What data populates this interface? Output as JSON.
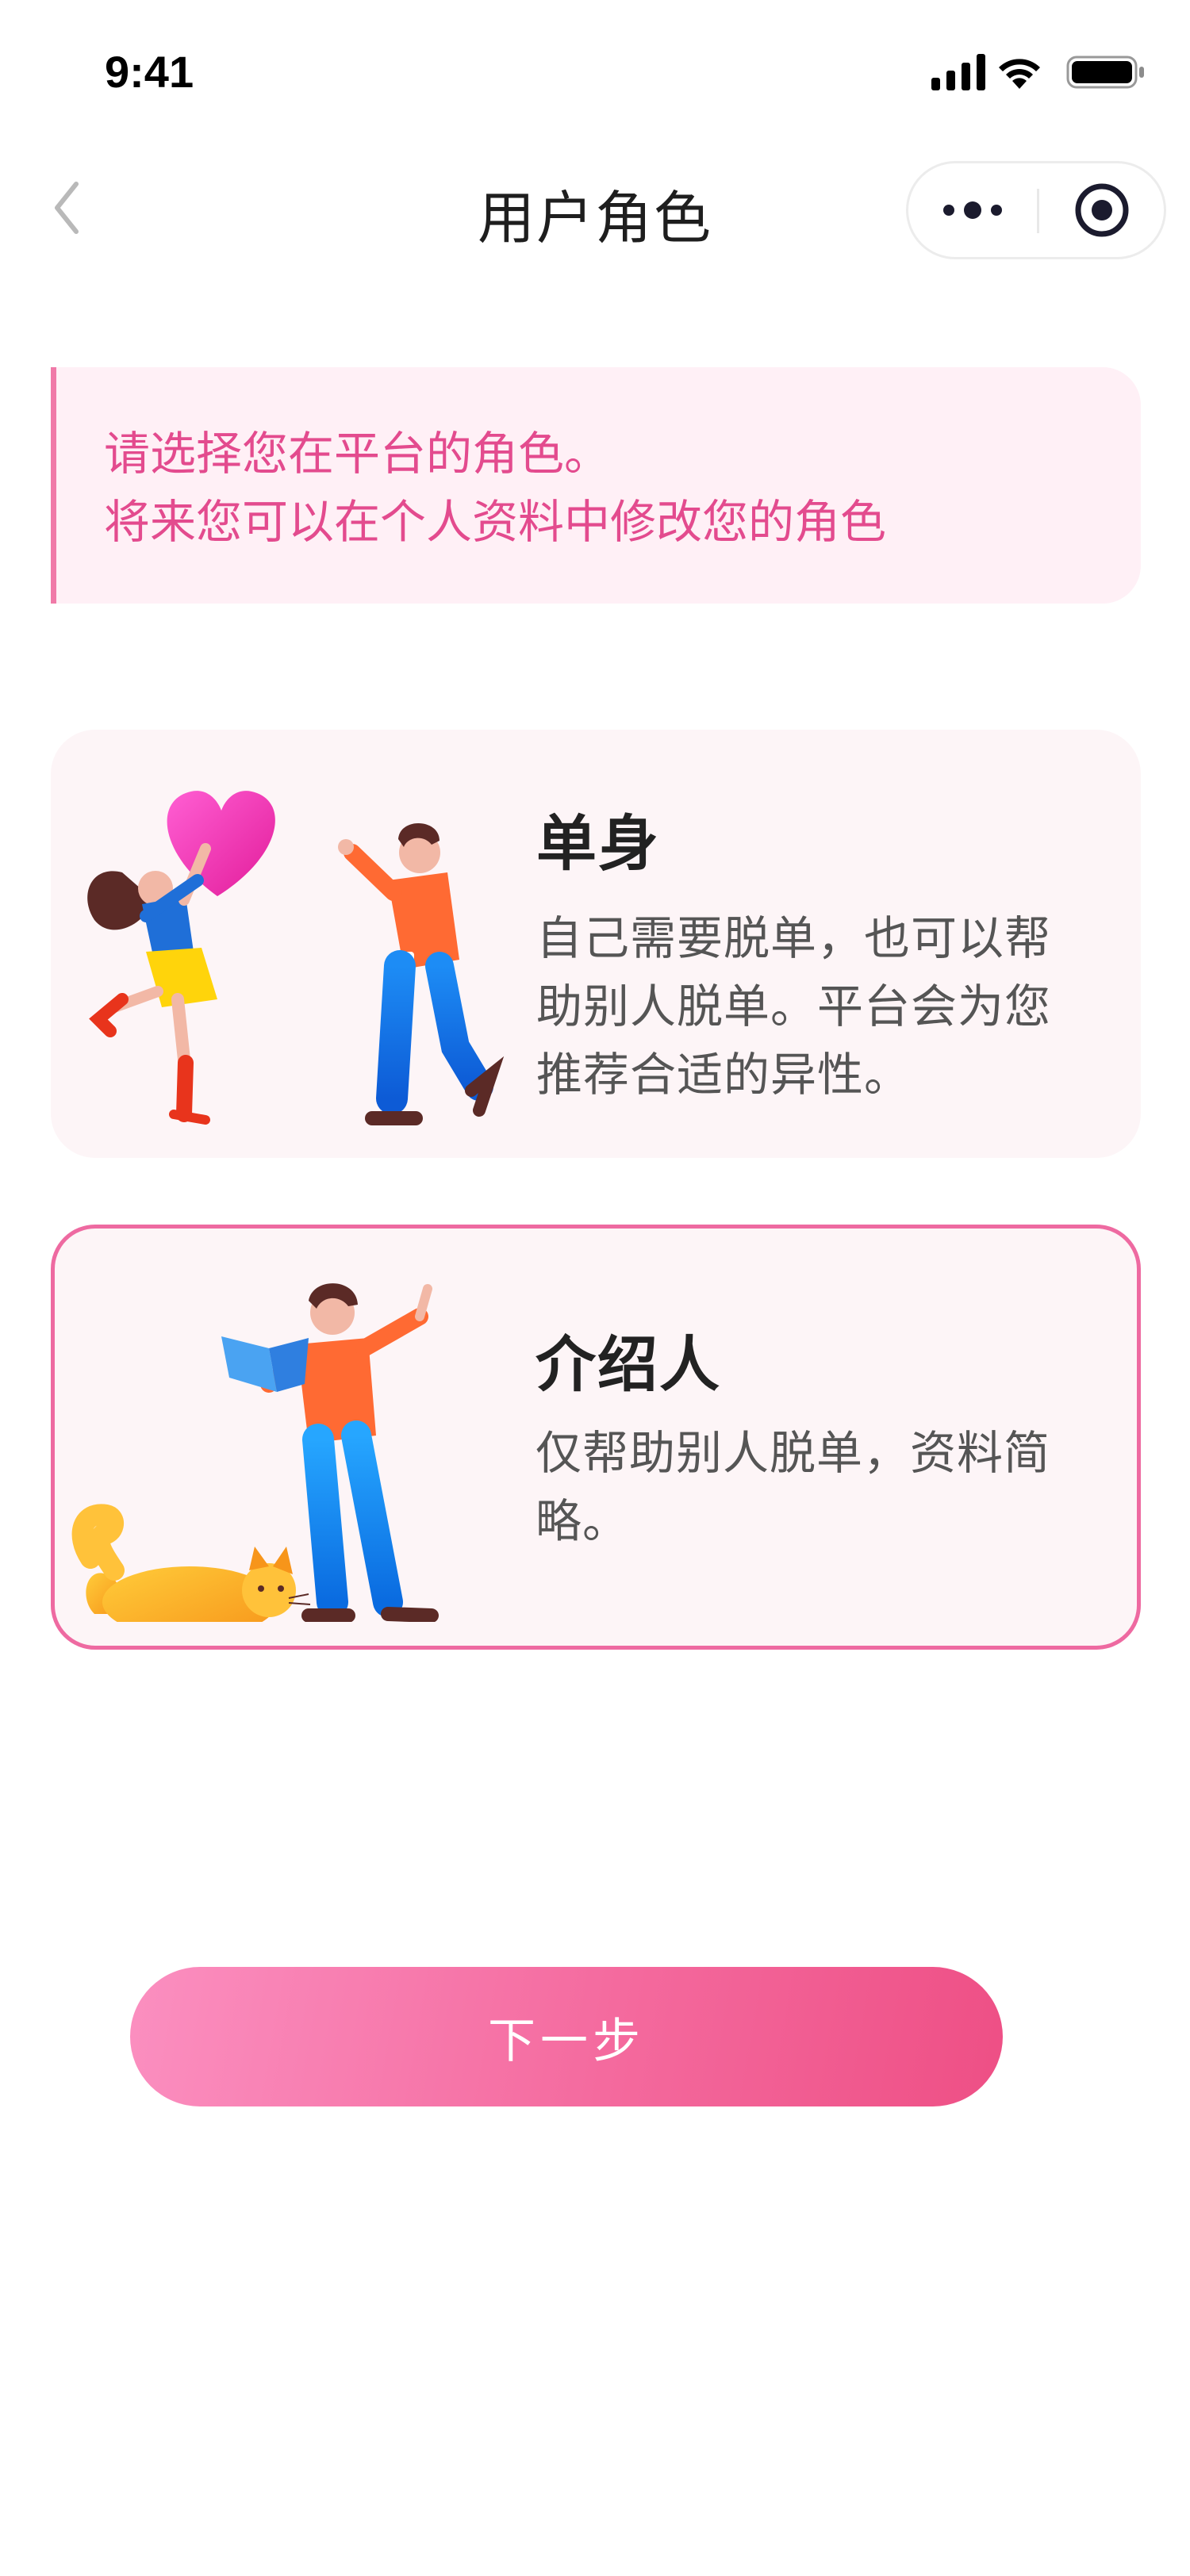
{
  "status_bar": {
    "time": "9:41"
  },
  "nav": {
    "title": "用户角色"
  },
  "notice": {
    "line1": "请选择您在平台的角色。",
    "line2": "将来您可以在个人资料中修改您的角色"
  },
  "roles": [
    {
      "title": "单身",
      "description": "自己需要脱单，也可以帮助别人脱单。平台会为您推荐合适的异性。",
      "selected": false
    },
    {
      "title": "介绍人",
      "description": "仅帮助别人脱单，资料简略。",
      "selected": true
    }
  ],
  "next_button": {
    "label": "下一步"
  },
  "colors": {
    "accent_pink": "#ee6aa1",
    "notice_text": "#e34b8e",
    "notice_bg": "#fff0f6",
    "card_bg": "#fdf5f7"
  }
}
